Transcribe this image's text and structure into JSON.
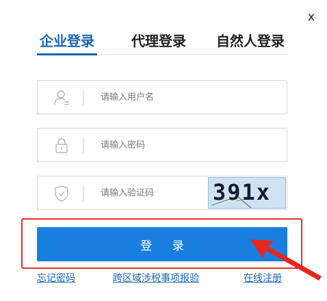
{
  "dialog": {
    "close_label": "x"
  },
  "tabs": [
    {
      "label": "企业登录"
    },
    {
      "label": "代理登录"
    },
    {
      "label": "自然人登录"
    }
  ],
  "form": {
    "username": {
      "placeholder": "请输入用户名",
      "icon": "user-icon"
    },
    "password": {
      "placeholder": "请输入密码",
      "icon": "lock-icon"
    },
    "captcha": {
      "placeholder": "请输入验证码",
      "icon": "shield-icon",
      "image_text": "391x"
    }
  },
  "login_button": {
    "label": "登 录"
  },
  "links": {
    "forgot_password": "忘记密码",
    "cross_region": "跨区域涉税事项报验",
    "register": "在线注册"
  },
  "colors": {
    "accent": "#1a66b8",
    "button": "#1a7ee0",
    "highlight": "#e0322b"
  }
}
